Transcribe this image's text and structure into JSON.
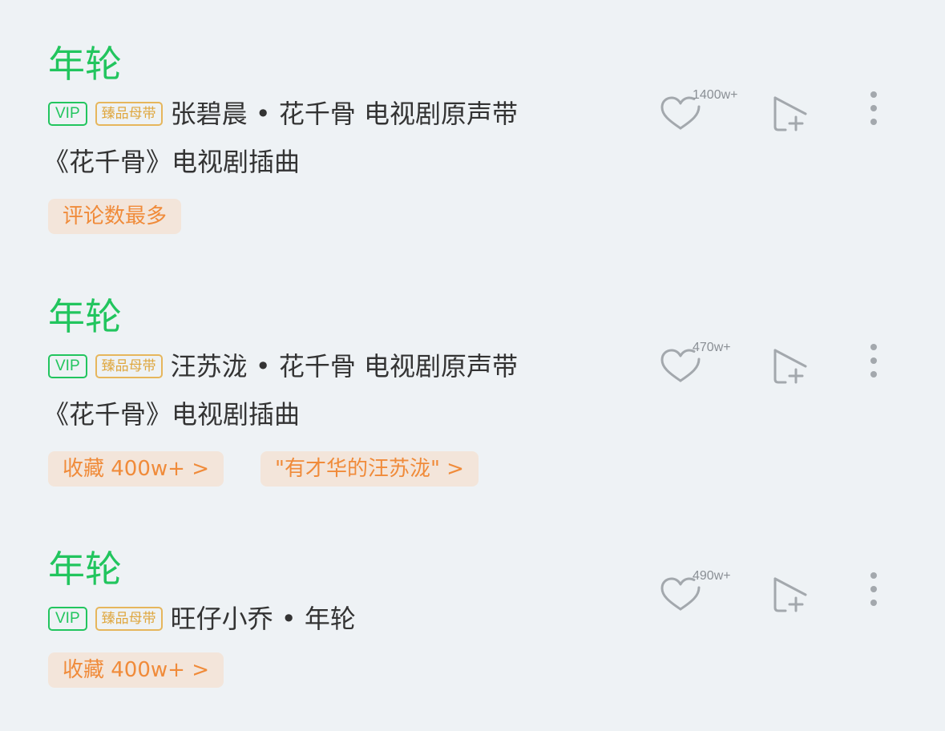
{
  "songs": [
    {
      "title": "年轮",
      "vip_badge": "VIP",
      "quality_badge": "臻品母带",
      "artist_album": "张碧晨 • 花千骨 电视剧原声带",
      "description": "《花千骨》电视剧插曲",
      "tags": [
        "评论数最多"
      ],
      "like_count": "1400w+"
    },
    {
      "title": "年轮",
      "vip_badge": "VIP",
      "quality_badge": "臻品母带",
      "artist_album": "汪苏泷 • 花千骨 电视剧原声带",
      "description": "《花千骨》电视剧插曲",
      "tags": [
        "收藏 400w+ >",
        "\"有才华的汪苏泷\" >"
      ],
      "like_count": "470w+"
    },
    {
      "title": "年轮",
      "vip_badge": "VIP",
      "quality_badge": "臻品母带",
      "artist_album": "旺仔小乔 • 年轮",
      "description": "",
      "tags": [
        "收藏 400w+ >"
      ],
      "like_count": "490w+"
    }
  ],
  "icons": {
    "like": "heart-icon",
    "add_to_playlist": "add-to-playlist-icon",
    "more": "more-vertical-icon"
  },
  "colors": {
    "background": "#EEF2F5",
    "title_green": "#22C55E",
    "quality_gold": "#E6B65C",
    "tag_orange": "#F08B3A",
    "tag_bg": "#F3E5DA",
    "icon_gray": "#A3A8AD"
  }
}
